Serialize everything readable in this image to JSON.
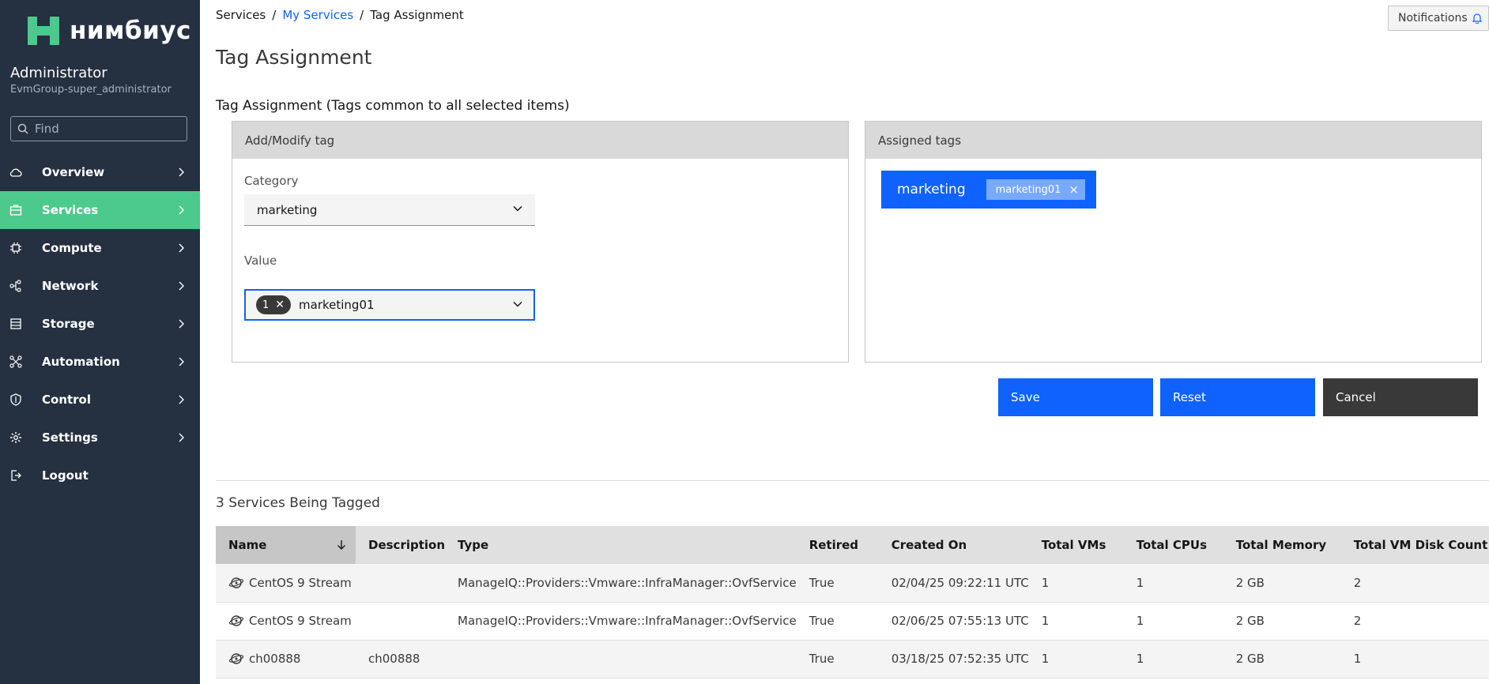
{
  "brand": {
    "logo_text": "нимбиус"
  },
  "user": {
    "name": "Administrator",
    "group": "EvmGroup-super_administrator"
  },
  "search": {
    "placeholder": "Find"
  },
  "nav": [
    {
      "label": "Overview",
      "icon": "cloud-icon",
      "active": false
    },
    {
      "label": "Services",
      "icon": "services-icon",
      "active": true
    },
    {
      "label": "Compute",
      "icon": "chip-icon",
      "active": false
    },
    {
      "label": "Network",
      "icon": "network-icon",
      "active": false
    },
    {
      "label": "Storage",
      "icon": "storage-icon",
      "active": false
    },
    {
      "label": "Automation",
      "icon": "automation-icon",
      "active": false
    },
    {
      "label": "Control",
      "icon": "shield-icon",
      "active": false
    },
    {
      "label": "Settings",
      "icon": "gear-icon",
      "active": false
    },
    {
      "label": "Logout",
      "icon": "logout-icon",
      "active": false
    }
  ],
  "breadcrumb": {
    "root": "Services",
    "parent": "My Services",
    "current": "Tag Assignment",
    "separator": "/"
  },
  "notifications": {
    "label": "Notifications"
  },
  "page": {
    "title": "Tag Assignment",
    "section_title": "Tag Assignment (Tags common to all selected items)"
  },
  "add_modify": {
    "header": "Add/Modify tag",
    "category_label": "Category",
    "category_value": "marketing",
    "value_label": "Value",
    "value_count": "1",
    "value_selected": "marketing01"
  },
  "assigned": {
    "header": "Assigned tags",
    "tags": [
      {
        "category": "marketing",
        "value": "marketing01"
      }
    ]
  },
  "buttons": {
    "save": "Save",
    "reset": "Reset",
    "cancel": "Cancel"
  },
  "table": {
    "title": "3 Services Being Tagged",
    "columns": [
      "Name",
      "Description",
      "Type",
      "Retired",
      "Created On",
      "Total VMs",
      "Total CPUs",
      "Total Memory",
      "Total VM Disk Count"
    ],
    "rows": [
      [
        "CentOS 9 Stream",
        "",
        "ManageIQ::Providers::Vmware::InfraManager::OvfService",
        "True",
        "02/04/25 09:22:11 UTC",
        "1",
        "1",
        "2 GB",
        "2"
      ],
      [
        "CentOS 9 Stream",
        "",
        "ManageIQ::Providers::Vmware::InfraManager::OvfService",
        "True",
        "02/06/25 07:55:13 UTC",
        "1",
        "1",
        "2 GB",
        "2"
      ],
      [
        "ch00888",
        "ch00888",
        "",
        "True",
        "03/18/25 07:52:35 UTC",
        "1",
        "1",
        "2 GB",
        "1"
      ]
    ]
  },
  "colors": {
    "sidebar": "#253041",
    "active_nav": "#4cc98d",
    "primary": "#0f62fe",
    "secondary": "#393939"
  }
}
